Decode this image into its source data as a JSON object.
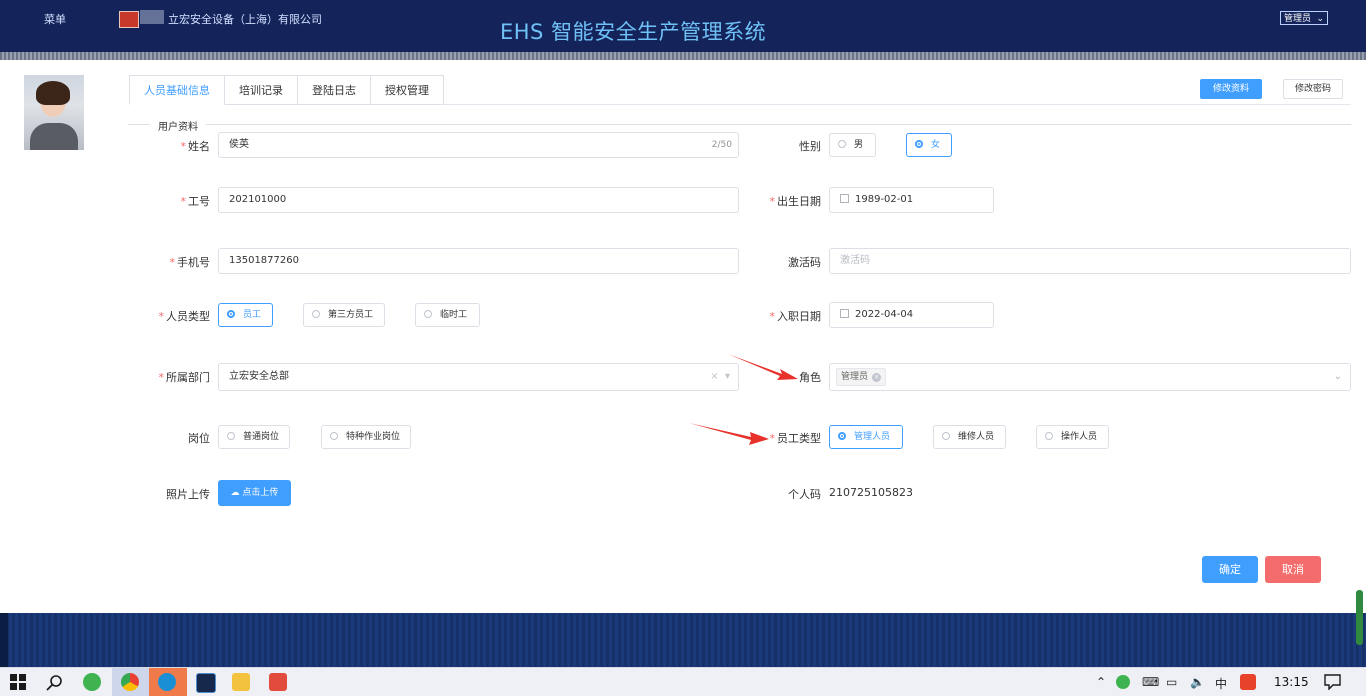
{
  "header": {
    "menu_label": "菜单",
    "company": "立宏安全设备（上海）有限公司",
    "title": "EHS 智能安全生产管理系统",
    "role_select": "管理员"
  },
  "tabs": [
    "人员基础信息",
    "培训记录",
    "登陆日志",
    "授权管理"
  ],
  "actions": {
    "edit_profile": "修改资料",
    "change_password": "修改密码"
  },
  "section_title": "用户资料",
  "form": {
    "name": {
      "label": "姓名",
      "value": "侯英",
      "counter": "2/50"
    },
    "gender": {
      "label": "性别",
      "options": [
        "男",
        "女"
      ],
      "selected": "女"
    },
    "employee_no": {
      "label": "工号",
      "value": "202101000"
    },
    "birth_date": {
      "label": "出生日期",
      "value": "1989-02-01"
    },
    "mobile": {
      "label": "手机号",
      "value": "13501877260"
    },
    "activation_code": {
      "label": "激活码",
      "placeholder": "激活码"
    },
    "person_type": {
      "label": "人员类型",
      "options": [
        "员工",
        "第三方员工",
        "临时工"
      ],
      "selected": "员工"
    },
    "hire_date": {
      "label": "入职日期",
      "value": "2022-04-04"
    },
    "department": {
      "label": "所属部门",
      "value": "立宏安全总部"
    },
    "role": {
      "label": "角色",
      "tag": "管理员"
    },
    "post": {
      "label": "岗位",
      "options": [
        "普通岗位",
        "特种作业岗位"
      ],
      "selected": ""
    },
    "staff_type": {
      "label": "员工类型",
      "options": [
        "管理人员",
        "维修人员",
        "操作人员"
      ],
      "selected": "管理人员"
    },
    "photo": {
      "label": "照片上传",
      "button": "点击上传"
    },
    "personal_code": {
      "label": "个人码",
      "value": "210725105823"
    }
  },
  "footer_buttons": {
    "confirm": "确定",
    "cancel": "取消"
  },
  "taskbar": {
    "time": "13:15",
    "ime": "中"
  },
  "colors": {
    "primary": "#409eff",
    "danger": "#f56c6c",
    "header_bg": "#14245a",
    "title": "#6fc1f6",
    "arrow": "#e8312a"
  }
}
